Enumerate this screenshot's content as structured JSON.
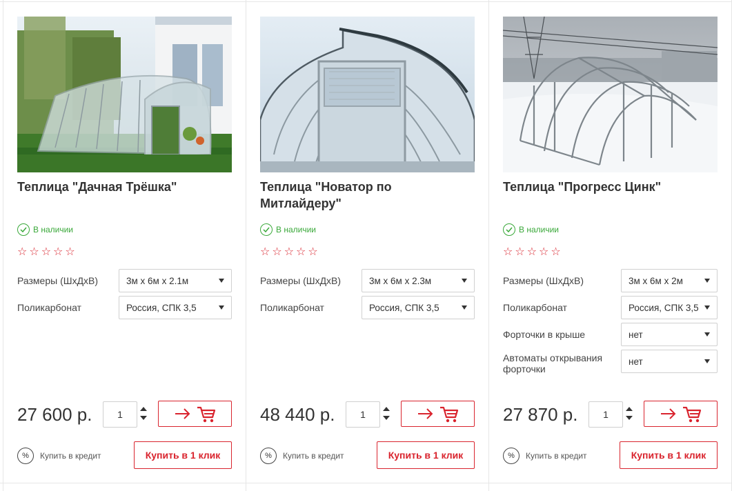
{
  "colors": {
    "accent": "#d9232d",
    "in_stock": "#39a839",
    "border": "#e6e6e6"
  },
  "products": [
    {
      "title": "Теплица \"Дачная Трёшка\"",
      "stock": "В наличии",
      "rating": 0,
      "options": [
        {
          "label": "Размеры (ШхДхВ)",
          "value": "3м х 6м х 2.1м"
        },
        {
          "label": "Поликарбонат",
          "value": "Россия, СПК 3,5"
        }
      ],
      "price": "27 600 р.",
      "qty": "1",
      "credit": "Купить в кредит",
      "one_click": "Купить в 1 клик",
      "photo": "greenhouse-lawn-photo"
    },
    {
      "title": "Теплица \"Новатор по Митлайдеру\"",
      "stock": "В наличии",
      "rating": 0,
      "options": [
        {
          "label": "Размеры (ШхДхВ)",
          "value": "3м х 6м х 2.3м"
        },
        {
          "label": "Поликарбонат",
          "value": "Россия, СПК 3,5"
        }
      ],
      "price": "48 440 р.",
      "qty": "1",
      "credit": "Купить в кредит",
      "one_click": "Купить в 1 клик",
      "photo": "greenhouse-interior-photo"
    },
    {
      "title": "Теплица \"Прогресс Цинк\"",
      "stock": "В наличии",
      "rating": 0,
      "options": [
        {
          "label": "Размеры (ШхДхВ)",
          "value": "3м х 6м х 2м"
        },
        {
          "label": "Поликарбонат",
          "value": "Россия, СПК 3,5"
        },
        {
          "label": "Форточки в крыше",
          "value": "нет"
        },
        {
          "label": "Автоматы открывания форточки",
          "value": "нет"
        }
      ],
      "price": "27 870 р.",
      "qty": "1",
      "credit": "Купить в кредит",
      "one_click": "Купить в 1 клик",
      "photo": "greenhouse-frame-snow-photo"
    }
  ]
}
